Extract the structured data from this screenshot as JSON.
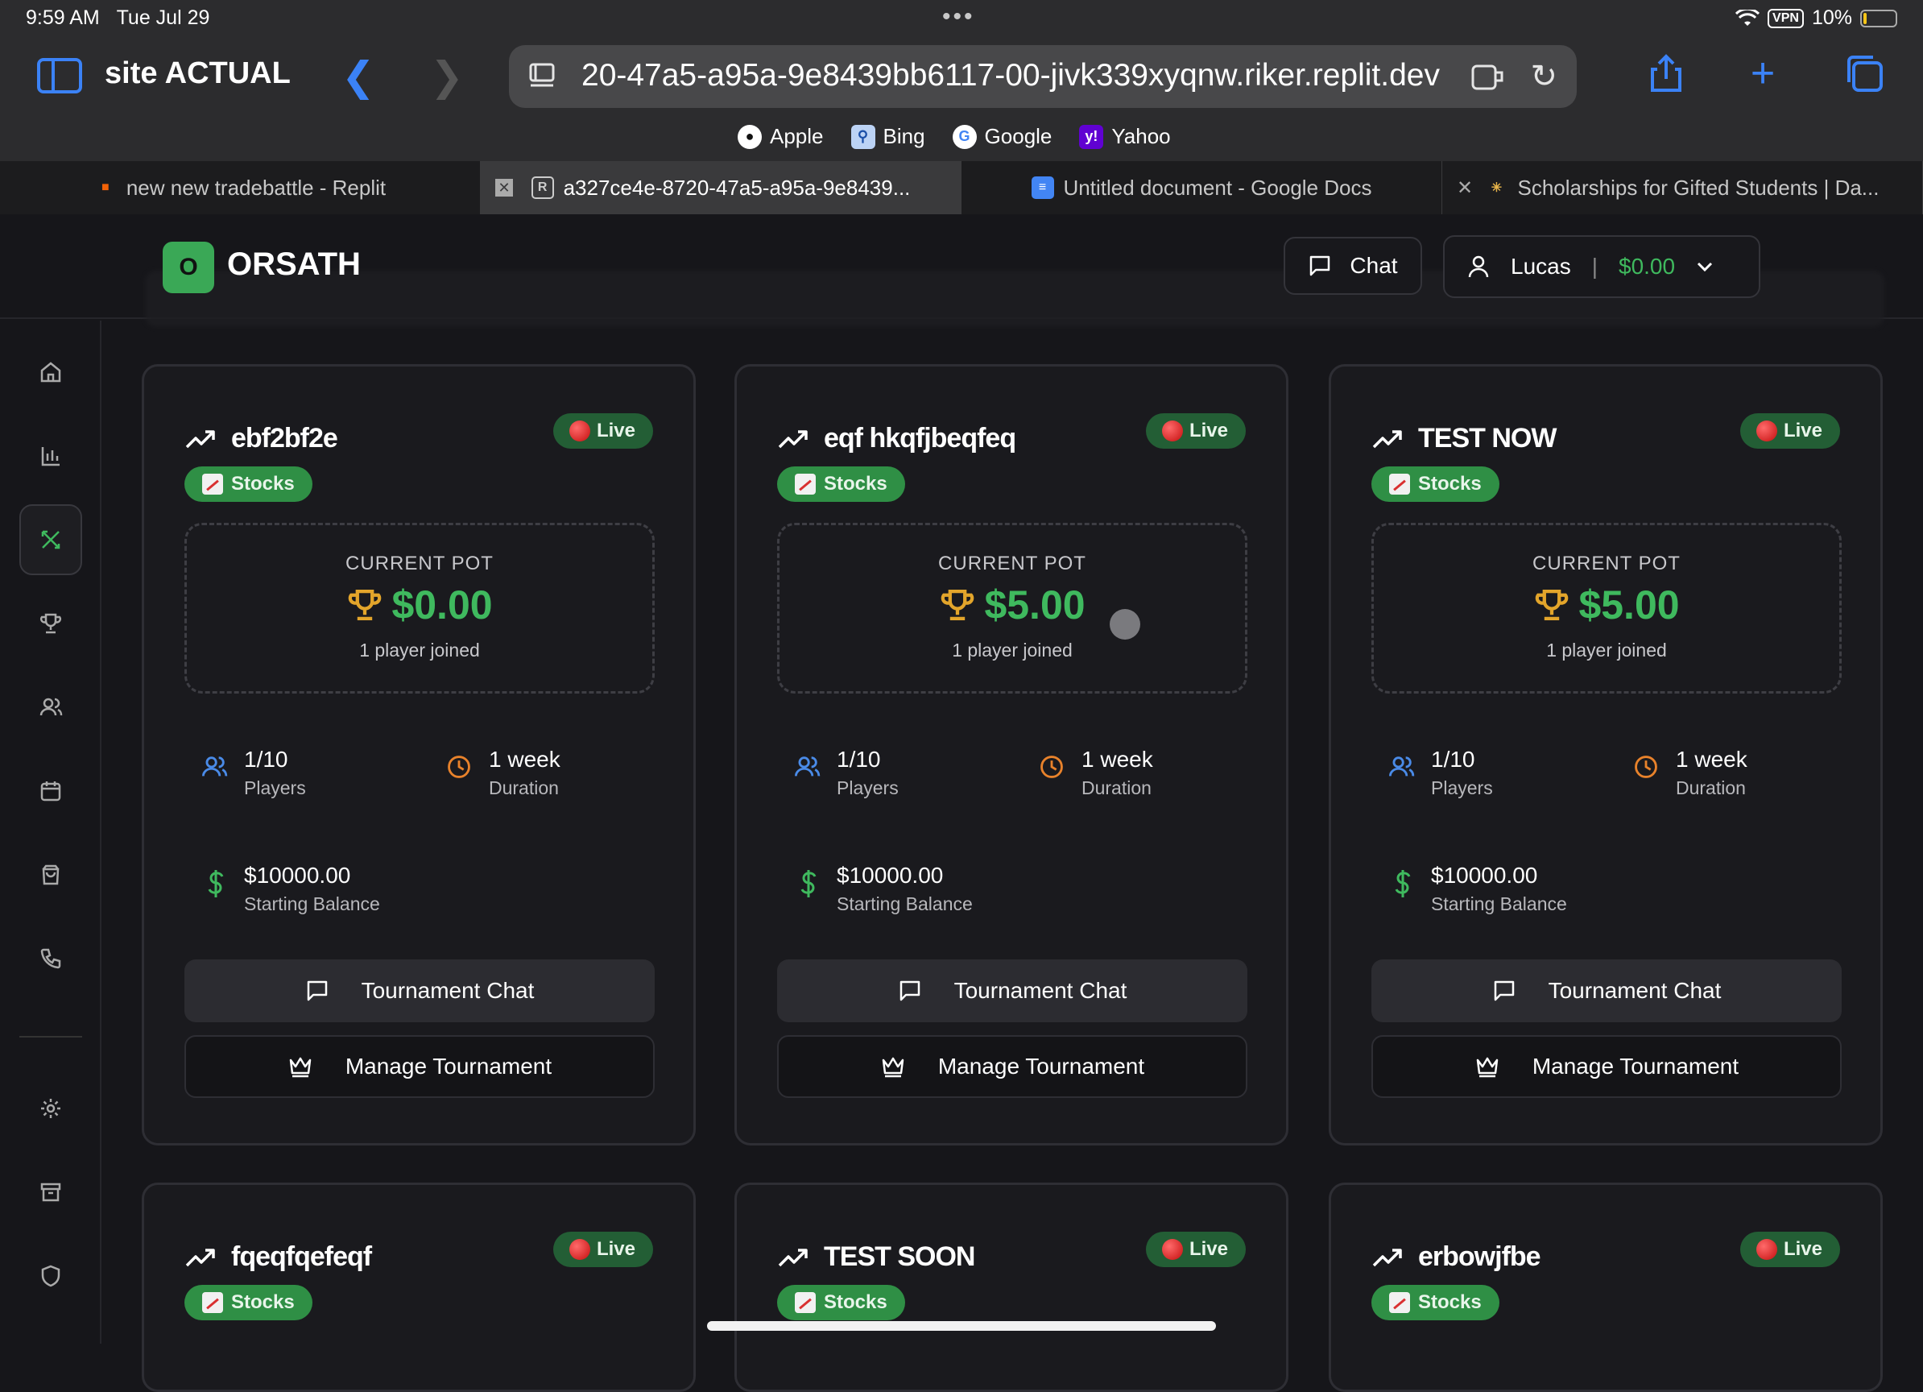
{
  "status_bar": {
    "time": "9:59 AM",
    "date": "Tue Jul 29",
    "vpn": "VPN",
    "battery": "10%",
    "battery_level": 0.1
  },
  "browser": {
    "site_name": "site ACTUAL",
    "url": "20-47a5-a95a-9e8439bb6117-00-jivk339xyqnw.riker.replit.dev",
    "favorites": [
      {
        "label": "Apple",
        "icon": "apple-icon"
      },
      {
        "label": "Bing",
        "icon": "bing-icon"
      },
      {
        "label": "Google",
        "icon": "google-icon"
      },
      {
        "label": "Yahoo",
        "icon": "yahoo-icon"
      }
    ],
    "tabs": [
      {
        "label": "new new tradebattle - Replit",
        "icon": "replit-icon",
        "active": false
      },
      {
        "label": "a327ce4e-8720-47a5-a95a-9e8439...",
        "icon": "r-icon",
        "active": true
      },
      {
        "label": "Untitled document - Google Docs",
        "icon": "google-docs-icon",
        "active": false
      },
      {
        "label": "Scholarships for Gifted Students | Da...",
        "icon": "star-burst-icon",
        "active": false
      }
    ]
  },
  "app": {
    "logo_letter": "O",
    "logo_text": "ORSATH",
    "chat_label": "Chat",
    "user_name": "Lucas",
    "user_separator": "|",
    "user_balance": "$0.00",
    "accent": "#3fb95e"
  },
  "sidebar": [
    "home-icon",
    "bar-chart-icon",
    "swords-icon",
    "trophy-icon",
    "users-icon",
    "calendar-icon",
    "shopping-bag-icon",
    "phone-icon",
    "settings-icon",
    "archive-icon",
    "shield-icon"
  ],
  "card_labels": {
    "live": "Live",
    "category": "Stocks",
    "pot_label": "CURRENT POT",
    "players_label": "Players",
    "duration_label": "Duration",
    "balance_label": "Starting Balance",
    "chat_button": "Tournament Chat",
    "manage_button": "Manage Tournament"
  },
  "tournaments": [
    {
      "name": "ebf2bf2e",
      "pot": "$0.00",
      "joined": "1 player joined",
      "players": "1/10",
      "duration": "1 week",
      "balance": "$10000.00"
    },
    {
      "name": "eqf hkqfjbeqfeq",
      "pot": "$5.00",
      "joined": "1 player joined",
      "players": "1/10",
      "duration": "1 week",
      "balance": "$10000.00"
    },
    {
      "name": "TEST NOW",
      "pot": "$5.00",
      "joined": "1 player joined",
      "players": "1/10",
      "duration": "1 week",
      "balance": "$10000.00"
    },
    {
      "name": "fqeqfqefeqf"
    },
    {
      "name": "TEST SOON"
    },
    {
      "name": "erbowjfbe"
    }
  ]
}
